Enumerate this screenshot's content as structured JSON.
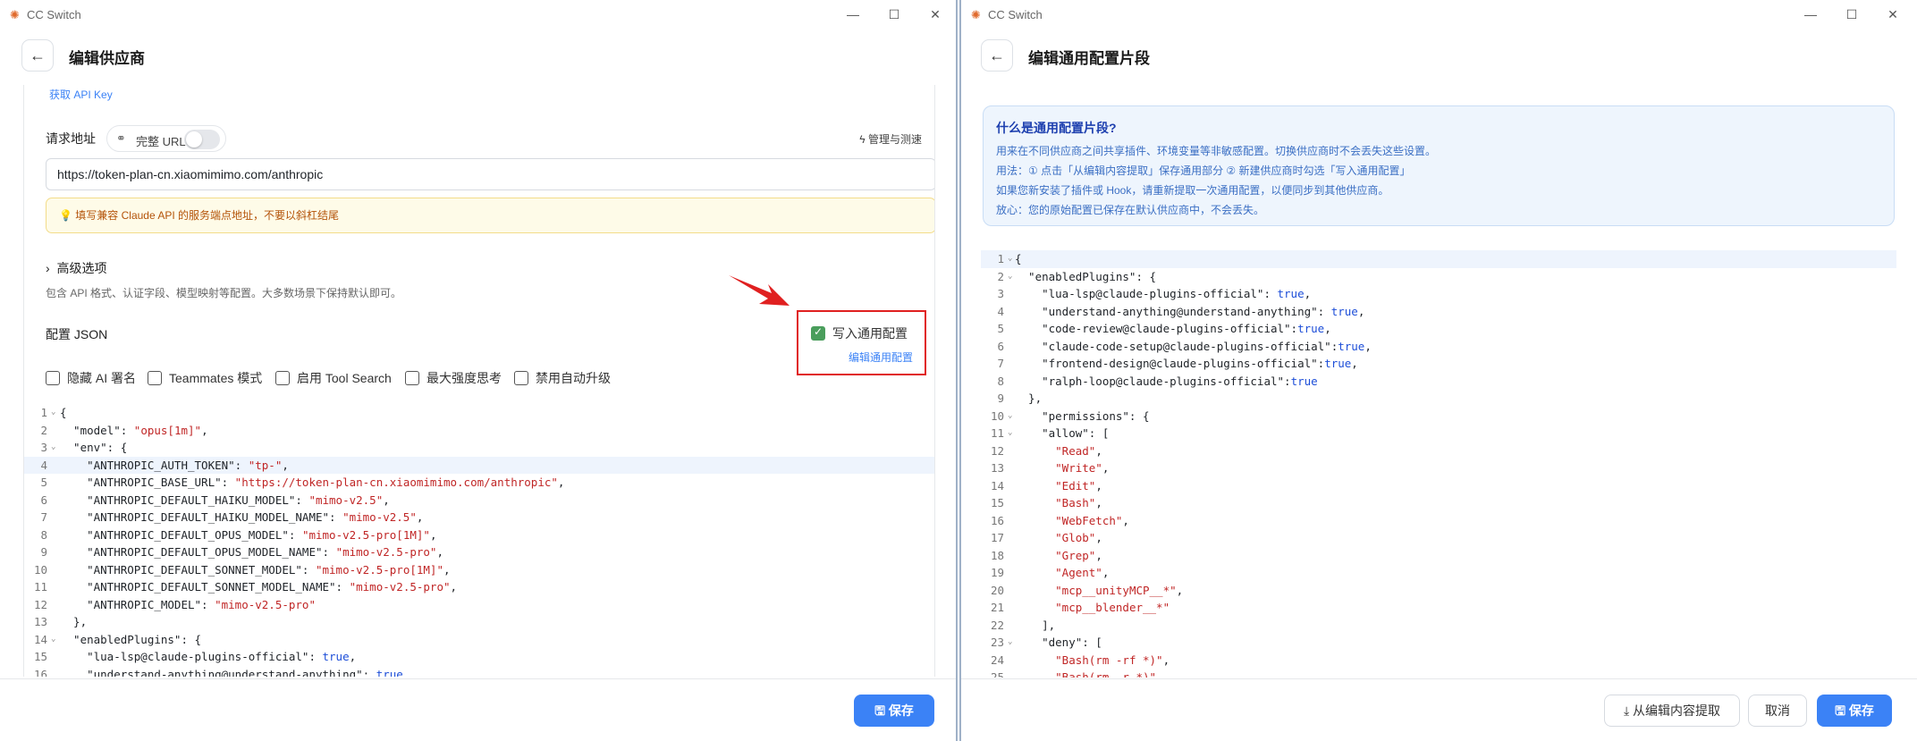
{
  "left": {
    "app_title": "CC Switch",
    "page_title": "编辑供应商",
    "get_api_key": "获取 API Key",
    "request_url_label": "请求地址",
    "full_url_label": "完整 URL",
    "manage_test": "管理与测速",
    "url_value": "https://token-plan-cn.xiaomimimo.com/anthropic",
    "hint": "填写兼容 Claude API 的服务端点地址，不要以斜杠结尾",
    "advanced_title": "高级选项",
    "advanced_desc": "包含 API 格式、认证字段、模型映射等配置。大多数场景下保持默认即可。",
    "config_json_label": "配置 JSON",
    "write_common_config": "写入通用配置",
    "edit_common_config": "编辑通用配置",
    "options": [
      "隐藏 AI 署名",
      "Teammates 模式",
      "启用 Tool Search",
      "最大强度思考",
      "禁用自动升级"
    ],
    "code_lines": [
      [
        {
          "t": "{"
        }
      ],
      [
        {
          "t": "  \"model\": "
        },
        {
          "s": "\"opus[1m]\""
        },
        {
          "t": ","
        }
      ],
      [
        {
          "t": "  \"env\": {"
        }
      ],
      [
        {
          "t": "    \"ANTHROPIC_AUTH_TOKEN\": "
        },
        {
          "s": "\"tp-\""
        },
        {
          "t": ","
        }
      ],
      [
        {
          "t": "    \"ANTHROPIC_BASE_URL\": "
        },
        {
          "s": "\"https://token-plan-cn.xiaomimimo.com/anthropic\""
        },
        {
          "t": ","
        }
      ],
      [
        {
          "t": "    \"ANTHROPIC_DEFAULT_HAIKU_MODEL\": "
        },
        {
          "s": "\"mimo-v2.5\""
        },
        {
          "t": ","
        }
      ],
      [
        {
          "t": "    \"ANTHROPIC_DEFAULT_HAIKU_MODEL_NAME\": "
        },
        {
          "s": "\"mimo-v2.5\""
        },
        {
          "t": ","
        }
      ],
      [
        {
          "t": "    \"ANTHROPIC_DEFAULT_OPUS_MODEL\": "
        },
        {
          "s": "\"mimo-v2.5-pro[1M]\""
        },
        {
          "t": ","
        }
      ],
      [
        {
          "t": "    \"ANTHROPIC_DEFAULT_OPUS_MODEL_NAME\": "
        },
        {
          "s": "\"mimo-v2.5-pro\""
        },
        {
          "t": ","
        }
      ],
      [
        {
          "t": "    \"ANTHROPIC_DEFAULT_SONNET_MODEL\": "
        },
        {
          "s": "\"mimo-v2.5-pro[1M]\""
        },
        {
          "t": ","
        }
      ],
      [
        {
          "t": "    \"ANTHROPIC_DEFAULT_SONNET_MODEL_NAME\": "
        },
        {
          "s": "\"mimo-v2.5-pro\""
        },
        {
          "t": ","
        }
      ],
      [
        {
          "t": "    \"ANTHROPIC_MODEL\": "
        },
        {
          "s": "\"mimo-v2.5-pro\""
        }
      ],
      [
        {
          "t": "  },"
        }
      ],
      [
        {
          "t": "  \"enabledPlugins\": {"
        }
      ],
      [
        {
          "t": "    \"lua-lsp@claude-plugins-official\": "
        },
        {
          "k": "true"
        },
        {
          "t": ","
        }
      ],
      [
        {
          "t": "    \"understand-anything@understand-anything\": "
        },
        {
          "k": "true"
        }
      ]
    ],
    "fold_lines": [
      1,
      3,
      14
    ],
    "save": "保存"
  },
  "right": {
    "app_title": "CC Switch",
    "page_title": "编辑通用配置片段",
    "info_title": "什么是通用配置片段?",
    "info_lines": [
      "用来在不同供应商之间共享插件、环境变量等非敏感配置。切换供应商时不会丢失这些设置。",
      "用法：① 点击「从编辑内容提取」保存通用部分 ② 新建供应商时勾选「写入通用配置」",
      "如果您新安装了插件或 Hook，请重新提取一次通用配置，以便同步到其他供应商。",
      "放心：您的原始配置已保存在默认供应商中，不会丢失。"
    ],
    "code_lines": [
      [
        {
          "t": "{"
        }
      ],
      [
        {
          "t": "  \"enabledPlugins\": {"
        }
      ],
      [
        {
          "t": "    \"lua-lsp@claude-plugins-official\": "
        },
        {
          "k": "true"
        },
        {
          "t": ","
        }
      ],
      [
        {
          "t": "    \"understand-anything@understand-anything\": "
        },
        {
          "k": "true"
        },
        {
          "t": ","
        }
      ],
      [
        {
          "t": "    \"code-review@claude-plugins-official\":"
        },
        {
          "k": "true"
        },
        {
          "t": ","
        }
      ],
      [
        {
          "t": "    \"claude-code-setup@claude-plugins-official\":"
        },
        {
          "k": "true"
        },
        {
          "t": ","
        }
      ],
      [
        {
          "t": "    \"frontend-design@claude-plugins-official\":"
        },
        {
          "k": "true"
        },
        {
          "t": ","
        }
      ],
      [
        {
          "t": "    \"ralph-loop@claude-plugins-official\":"
        },
        {
          "k": "true"
        }
      ],
      [
        {
          "t": "  },"
        }
      ],
      [
        {
          "t": "    \"permissions\": {"
        }
      ],
      [
        {
          "t": "    \"allow\": ["
        }
      ],
      [
        {
          "t": "      "
        },
        {
          "s": "\"Read\""
        },
        {
          "t": ","
        }
      ],
      [
        {
          "t": "      "
        },
        {
          "s": "\"Write\""
        },
        {
          "t": ","
        }
      ],
      [
        {
          "t": "      "
        },
        {
          "s": "\"Edit\""
        },
        {
          "t": ","
        }
      ],
      [
        {
          "t": "      "
        },
        {
          "s": "\"Bash\""
        },
        {
          "t": ","
        }
      ],
      [
        {
          "t": "      "
        },
        {
          "s": "\"WebFetch\""
        },
        {
          "t": ","
        }
      ],
      [
        {
          "t": "      "
        },
        {
          "s": "\"Glob\""
        },
        {
          "t": ","
        }
      ],
      [
        {
          "t": "      "
        },
        {
          "s": "\"Grep\""
        },
        {
          "t": ","
        }
      ],
      [
        {
          "t": "      "
        },
        {
          "s": "\"Agent\""
        },
        {
          "t": ","
        }
      ],
      [
        {
          "t": "      "
        },
        {
          "s": "\"mcp__unityMCP__*\""
        },
        {
          "t": ","
        }
      ],
      [
        {
          "t": "      "
        },
        {
          "s": "\"mcp__blender__*\""
        }
      ],
      [
        {
          "t": "    ],"
        }
      ],
      [
        {
          "t": "    \"deny\": ["
        }
      ],
      [
        {
          "t": "      "
        },
        {
          "s": "\"Bash(rm -rf *)\""
        },
        {
          "t": ","
        }
      ],
      [
        {
          "t": "      "
        },
        {
          "s": "\"Bash(rm -r *)\""
        }
      ]
    ],
    "fold_lines": [
      1,
      2,
      10,
      11,
      23
    ],
    "extract": "从编辑内容提取",
    "cancel": "取消",
    "save": "保存"
  },
  "colors": {
    "accent": "#3b82f6",
    "annotation": "#e02020",
    "checkbox": "#4a9e5c"
  }
}
